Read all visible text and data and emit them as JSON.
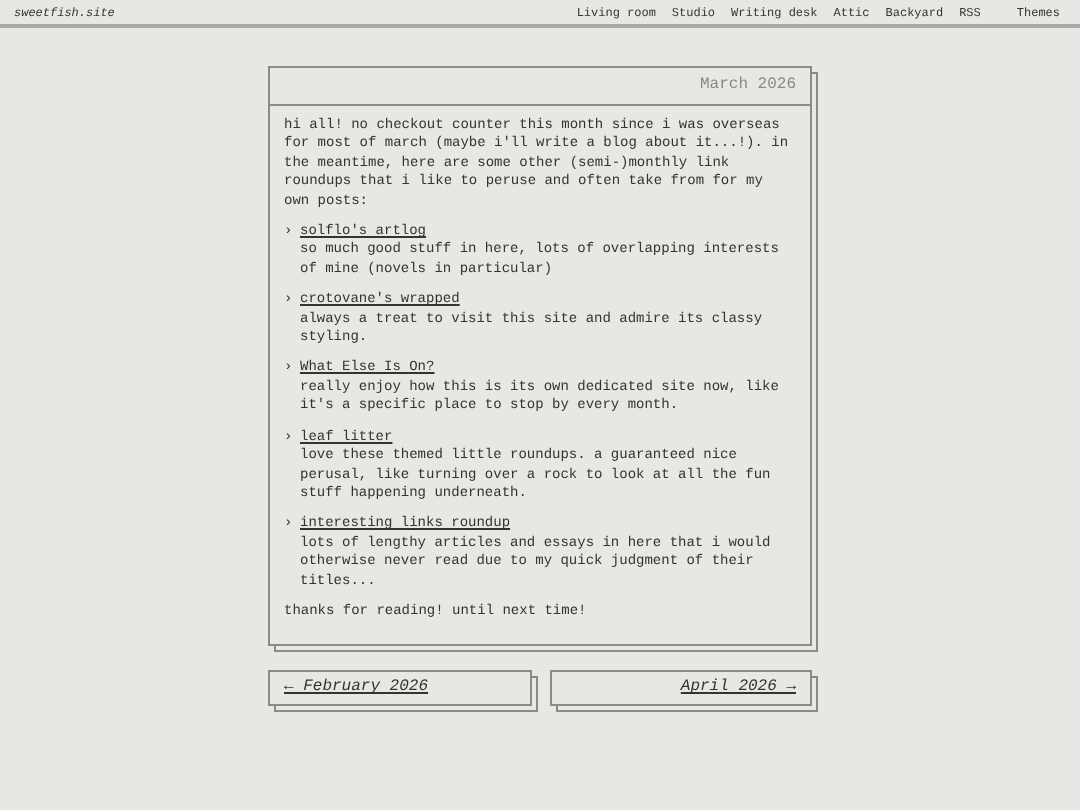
{
  "site_title": "sweetfish.site",
  "nav": [
    {
      "label": "Living room"
    },
    {
      "label": "Studio"
    },
    {
      "label": "Writing desk"
    },
    {
      "label": "Attic"
    },
    {
      "label": "Backyard"
    },
    {
      "label": "RSS"
    }
  ],
  "themes": "Themes",
  "post": {
    "date": "March 2026",
    "intro": "hi all! no checkout counter this month since i was overseas for most of march (maybe i'll write a blog about it...!). in the meantime, here are some other (semi-)monthly link roundups that i like to peruse and often take from for my own posts:",
    "links": [
      {
        "marker": "›",
        "title": "solflo's artlog",
        "description": "so much good stuff in here, lots of overlapping interests of mine (novels in particular)"
      },
      {
        "marker": "›",
        "title": "crotovane's wrapped",
        "description": "always a treat to visit this site and admire its classy styling."
      },
      {
        "marker": "›",
        "title": "What Else Is On?",
        "description": "really enjoy how this is its own dedicated site now, like it's a specific place to stop by every month."
      },
      {
        "marker": "›",
        "title": "leaf litter",
        "description": "love these themed little roundups. a guaranteed nice perusal, like turning over a rock to look at all the fun stuff happening underneath."
      },
      {
        "marker": "›",
        "title": "interesting links roundup",
        "description": "lots of lengthy articles and essays in here that i would otherwise never read due to my quick judgment of their titles..."
      }
    ],
    "outro": "thanks for reading! until next time!"
  },
  "pagination": {
    "previous": "← February 2026",
    "next": "April 2026 →"
  }
}
